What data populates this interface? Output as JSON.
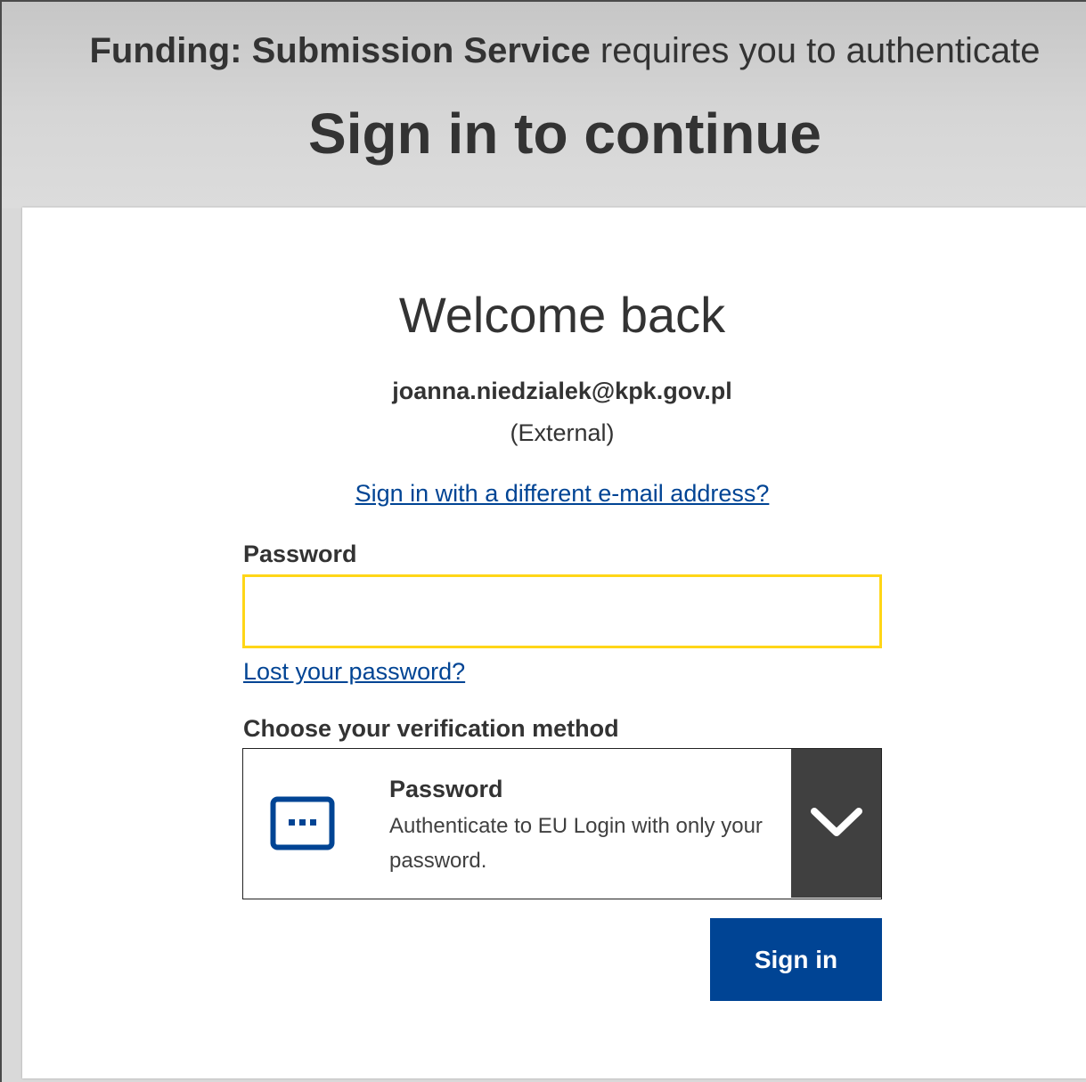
{
  "header": {
    "service_name": "Funding: Submission Service",
    "service_suffix": " requires you to authenticate",
    "title": "Sign in to continue"
  },
  "login": {
    "welcome": "Welcome back",
    "email": "joanna.niedzialek@kpk.gov.pl",
    "account_type": "(External)",
    "switch_account_link": "Sign in with a different e-mail address?",
    "password_label": "Password",
    "password_value": "",
    "lost_password_link": "Lost your password?",
    "verification_label": "Choose your verification method",
    "verification_method": {
      "name": "Password",
      "description": "Authenticate to EU Login with only your password.",
      "icon": "password-dots-icon",
      "dropdown_icon": "chevron-down-icon"
    },
    "sign_in_button": "Sign in"
  },
  "colors": {
    "primary_blue": "#004494",
    "focus_yellow": "#ffd617",
    "dark_gray": "#404040",
    "header_bg": "#d4d4d4"
  }
}
